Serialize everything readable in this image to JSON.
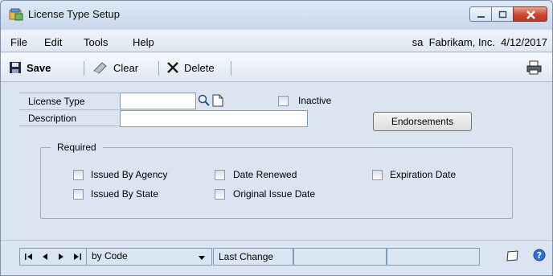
{
  "window": {
    "title": "License Type Setup"
  },
  "menu": {
    "items": [
      "File",
      "Edit",
      "Tools",
      "Help"
    ],
    "status": "sa  Fabrikam, Inc.  4/12/2017"
  },
  "toolbar": {
    "save_label": "Save",
    "clear_label": "Clear",
    "delete_label": "Delete"
  },
  "form": {
    "license_type_label": "License Type",
    "license_type_value": "",
    "description_label": "Description",
    "description_value": "",
    "inactive_label": "Inactive",
    "inactive_checked": false,
    "endorsements_label": "Endorsements",
    "required": {
      "legend": "Required",
      "items": [
        {
          "label": "Issued By Agency",
          "checked": false
        },
        {
          "label": "Date Renewed",
          "checked": false
        },
        {
          "label": "Expiration Date",
          "checked": false
        },
        {
          "label": "Issued By State",
          "checked": false
        },
        {
          "label": "Original Issue Date",
          "checked": false
        }
      ]
    }
  },
  "bottom": {
    "sort_value": "by Code",
    "last_change_label": "Last Change",
    "last_change_value_1": "",
    "last_change_value_2": ""
  }
}
